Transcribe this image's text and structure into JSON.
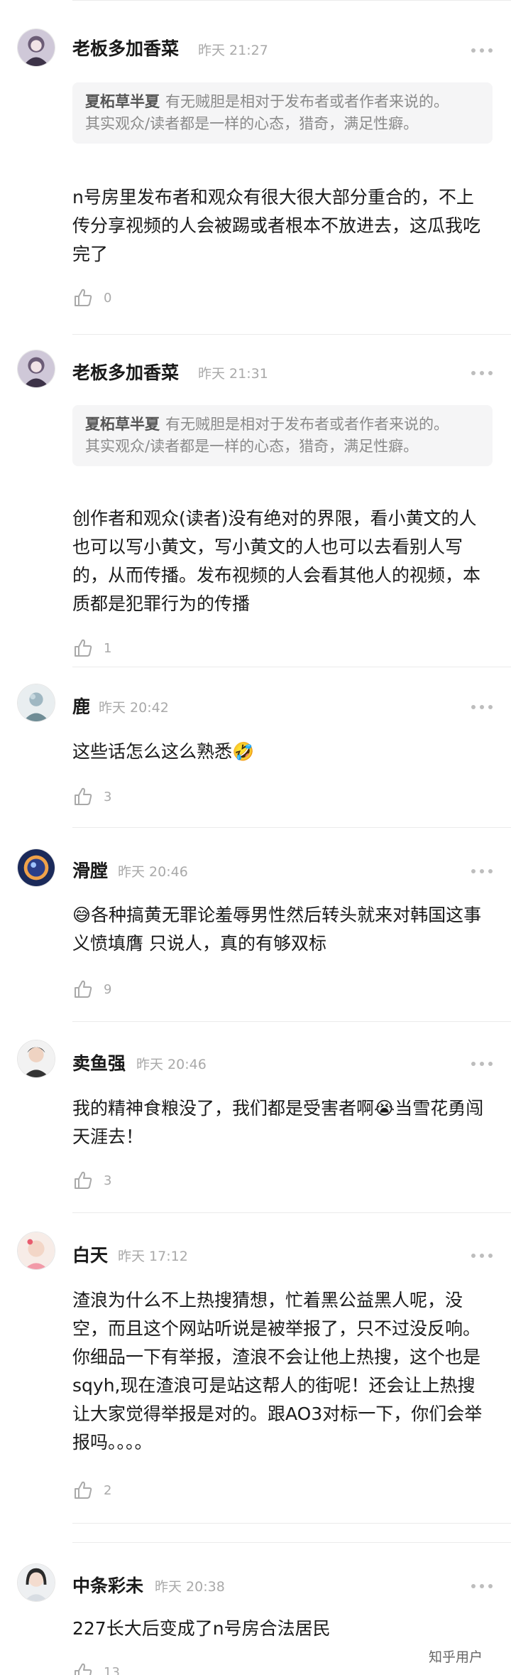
{
  "comments": [
    {
      "author": "老板多加香菜",
      "time": "昨天 21:27",
      "quote_author": "夏柘草半夏",
      "quote_line1": "有无贼胆是相对于发布者或者作者来说的。",
      "quote_line2": "其实观众/读者都是一样的心态，猎奇，满足性癖。",
      "body": "n号房里发布者和观众有很大很大部分重合的，不上传分享视频的人会被踢或者根本不放进去，这瓜我吃完了",
      "likes": "0"
    },
    {
      "author": "老板多加香菜",
      "time": "昨天 21:31",
      "quote_author": "夏柘草半夏",
      "quote_line1": "有无贼胆是相对于发布者或者作者来说的。",
      "quote_line2": "其实观众/读者都是一样的心态，猎奇，满足性癖。",
      "body": "创作者和观众(读者)没有绝对的界限，看小黄文的人也可以写小黄文，写小黄文的人也可以去看别人写的，从而传播。发布视频的人会看其他人的视频，本质都是犯罪行为的传播",
      "likes": "1"
    },
    {
      "author": "鹿",
      "time": "昨天 20:42",
      "body": "这些话怎么这么熟悉🤣",
      "likes": "3"
    },
    {
      "author": "滑膛",
      "time": "昨天 20:46",
      "body": "😅各种搞黄无罪论羞辱男性然后转头就来对韩国这事义愤填膺 只说人，真的有够双标",
      "likes": "9"
    },
    {
      "author": "卖鱼强",
      "time": "昨天 20:46",
      "body": "我的精神食粮没了，我们都是受害者啊😭当雪花勇闯天涯去！",
      "likes": "3"
    },
    {
      "author": "白天",
      "time": "昨天 17:12",
      "body": "渣浪为什么不上热搜猜想，忙着黑公益黑人呢，没空，而且这个网站听说是被举报了，只不过没反响。你细品一下有举报，渣浪不会让他上热搜，这个也是sqyh,现在渣浪可是站这帮人的街呢！还会让上热搜让大家觉得举报是对的。跟AO3对标一下，你们会举报吗。。。。",
      "likes": "2"
    },
    {
      "author": "中条彩未",
      "time": "昨天 20:38",
      "body": "227长大后变成了n号房合法居民",
      "likes": "13"
    }
  ],
  "watermark": "知乎用户",
  "icons": {
    "like": "thumbs-up-icon",
    "more": "more-dots-icon"
  }
}
